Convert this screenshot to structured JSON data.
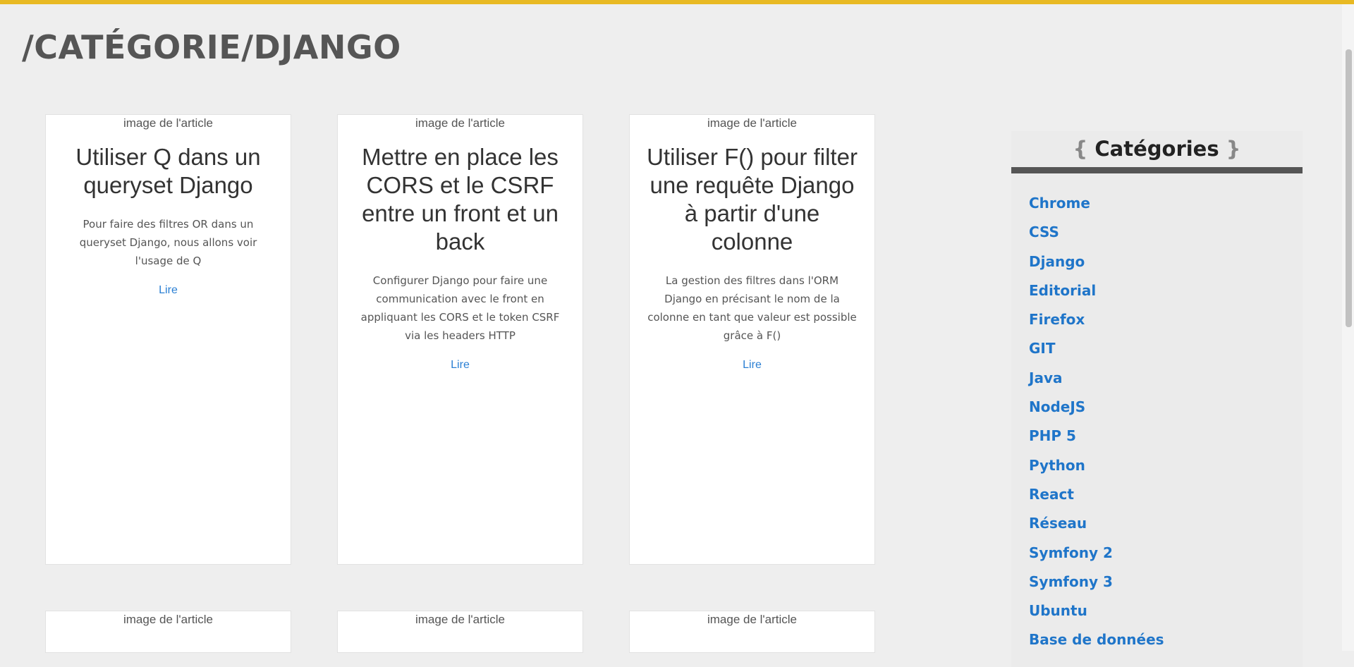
{
  "page": {
    "title": "/CATÉGORIE/DJANGO"
  },
  "colors": {
    "accent": "#e8b923",
    "link": "#1f75c9",
    "rule": "#555555"
  },
  "cards": [
    {
      "image_alt": "image de l'article",
      "title": "Utiliser Q dans un queryset Django",
      "excerpt": "Pour faire des filtres OR dans un queryset Django, nous allons voir l'usage de Q",
      "link_label": "Lire"
    },
    {
      "image_alt": "image de l'article",
      "title": "Mettre en place les CORS et le CSRF entre un front et un back",
      "excerpt": "Configurer Django pour faire une communication avec le front en appliquant les CORS et le token CSRF via les headers HTTP",
      "link_label": "Lire"
    },
    {
      "image_alt": "image de l'article",
      "title": "Utiliser F() pour filter une requête Django à partir d'une colonne",
      "excerpt": "La gestion des filtres dans l'ORM Django en précisant le nom de la colonne en tant que valeur est possible grâce à F()",
      "link_label": "Lire"
    },
    {
      "image_alt": "image de l'article"
    },
    {
      "image_alt": "image de l'article"
    },
    {
      "image_alt": "image de l'article"
    }
  ],
  "sidebar": {
    "brace_open": "{",
    "title": "Catégories",
    "brace_close": "}",
    "categories": [
      "Chrome",
      "CSS",
      "Django",
      "Editorial",
      "Firefox",
      "GIT",
      "Java",
      "NodeJS",
      "PHP 5",
      "Python",
      "React",
      "Réseau",
      "Symfony 2",
      "Symfony 3",
      "Ubuntu",
      "Base de données"
    ]
  }
}
